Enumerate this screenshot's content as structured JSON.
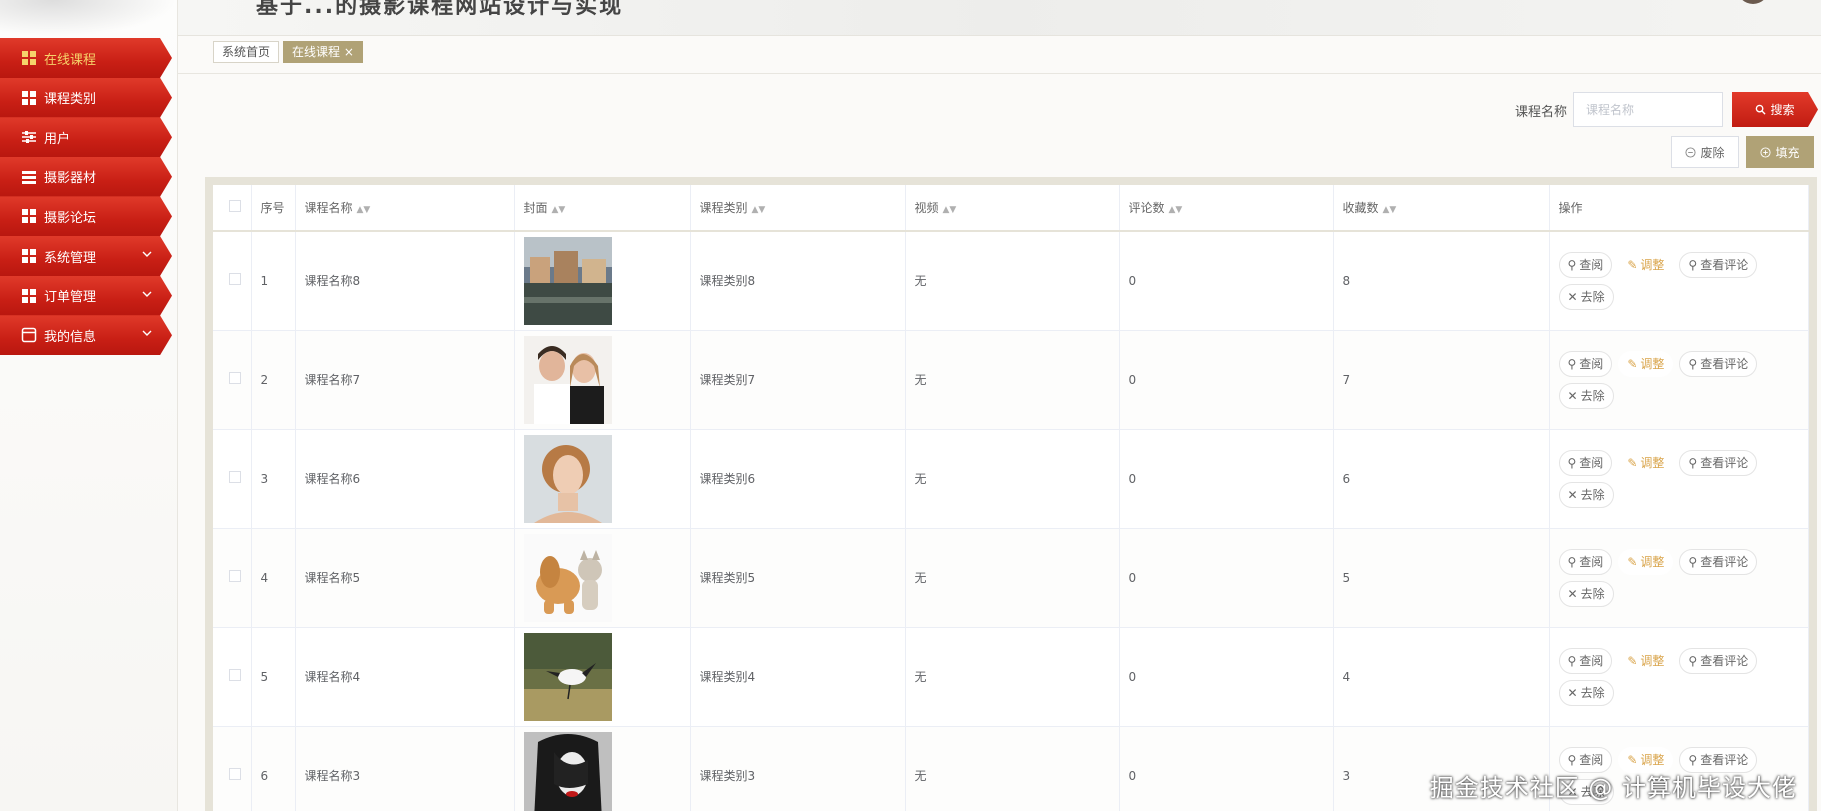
{
  "header": {
    "title": "基于...的摄影课程网站设计与实现",
    "avatar": "avatar"
  },
  "sidebar": {
    "items": [
      {
        "label": "在线课程",
        "icon": "grid-icon",
        "active": true,
        "expandable": false
      },
      {
        "label": "课程类别",
        "icon": "grid-icon",
        "active": false,
        "expandable": false
      },
      {
        "label": "用户",
        "icon": "sliders-icon",
        "active": false,
        "expandable": false
      },
      {
        "label": "摄影器材",
        "icon": "list-icon",
        "active": false,
        "expandable": false
      },
      {
        "label": "摄影论坛",
        "icon": "grid-icon",
        "active": false,
        "expandable": false
      },
      {
        "label": "系统管理",
        "icon": "grid-icon",
        "active": false,
        "expandable": true
      },
      {
        "label": "订单管理",
        "icon": "grid-icon",
        "active": false,
        "expandable": true
      },
      {
        "label": "我的信息",
        "icon": "window-icon",
        "active": false,
        "expandable": true
      }
    ]
  },
  "tabs": [
    {
      "label": "系统首页",
      "active": false
    },
    {
      "label": "在线课程",
      "active": true,
      "close": "×"
    }
  ],
  "search": {
    "label": "课程名称",
    "placeholder": "课程名称",
    "button": "搜索"
  },
  "actions": {
    "delete": "废除",
    "add": "填充"
  },
  "table": {
    "columns": [
      "序号",
      "课程名称",
      "封面",
      "课程类别",
      "视频",
      "评论数",
      "收藏数",
      "操作"
    ],
    "rows": [
      {
        "index": "1",
        "name": "课程名称8",
        "cover": "photo-town",
        "category": "课程类别8",
        "video": "无",
        "comments": "0",
        "favorites": "8"
      },
      {
        "index": "2",
        "name": "课程名称7",
        "cover": "photo-couple",
        "category": "课程类别7",
        "video": "无",
        "comments": "0",
        "favorites": "7"
      },
      {
        "index": "3",
        "name": "课程名称6",
        "cover": "photo-portrait",
        "category": "课程类别6",
        "video": "无",
        "comments": "0",
        "favorites": "6"
      },
      {
        "index": "4",
        "name": "课程名称5",
        "cover": "photo-pets",
        "category": "课程类别5",
        "video": "无",
        "comments": "0",
        "favorites": "5"
      },
      {
        "index": "5",
        "name": "课程名称4",
        "cover": "photo-bird",
        "category": "课程类别4",
        "video": "无",
        "comments": "0",
        "favorites": "4"
      },
      {
        "index": "6",
        "name": "课程名称3",
        "cover": "photo-woman",
        "category": "课程类别3",
        "video": "无",
        "comments": "0",
        "favorites": "3"
      }
    ],
    "row_actions": {
      "view": "查阅",
      "edit": "调整",
      "comments": "查看评论",
      "remove": "去除"
    }
  },
  "watermark": "掘金技术社区 @ 计算机毕设大佬",
  "colors": {
    "menu_red": "#c91f15",
    "accent_gold": "#b0a276",
    "active_text": "#f6d36a"
  }
}
